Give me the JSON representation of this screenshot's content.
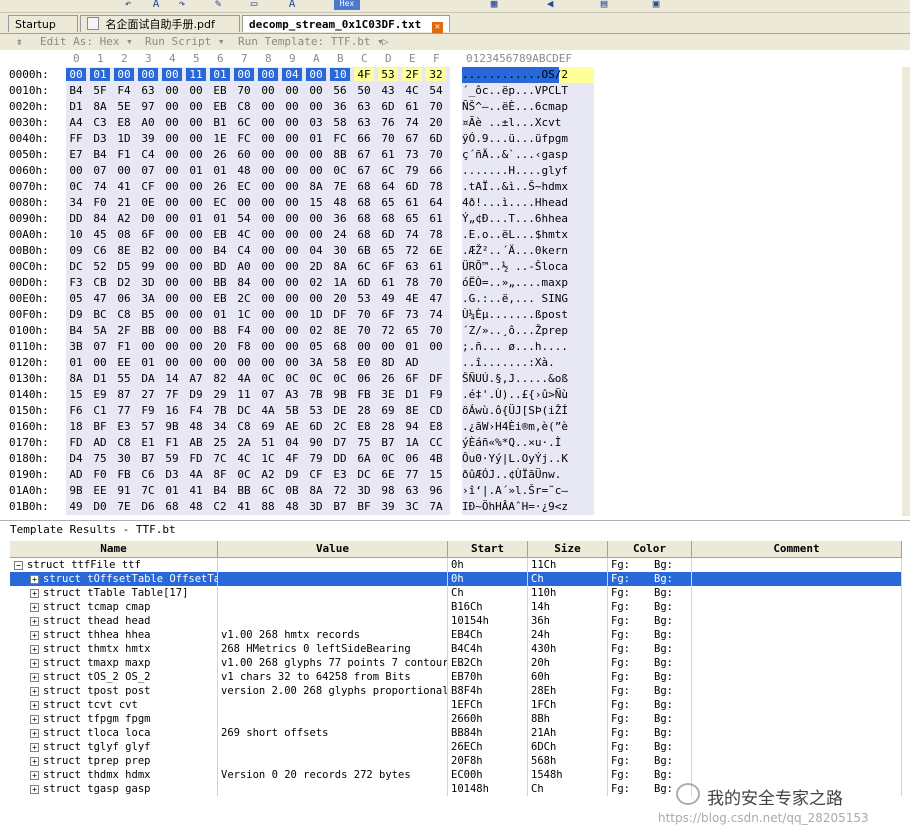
{
  "tabs": [
    {
      "label": "Startup",
      "active": false
    },
    {
      "label": "名企面试自助手册.pdf",
      "active": false
    },
    {
      "label": "decomp_stream_0x1C03DF.txt",
      "active": true
    }
  ],
  "editor_toolbar": {
    "edit_as": "Edit As: Hex",
    "run_script": "Run Script",
    "run_template": "Run Template: TTF.bt"
  },
  "hex_header": {
    "columns": [
      "0",
      "1",
      "2",
      "3",
      "4",
      "5",
      "6",
      "7",
      "8",
      "9",
      "A",
      "B",
      "C",
      "D",
      "E",
      "F"
    ],
    "ascii_header": "0123456789ABCDEF"
  },
  "hex_rows": [
    {
      "addr": "0000h:",
      "bytes": [
        "00",
        "01",
        "00",
        "00",
        "00",
        "11",
        "01",
        "00",
        "00",
        "04",
        "00",
        "10",
        "4F",
        "53",
        "2F",
        "32"
      ],
      "ascii": "............OS/2"
    },
    {
      "addr": "0010h:",
      "bytes": [
        "B4",
        "5F",
        "F4",
        "63",
        "00",
        "00",
        "EB",
        "70",
        "00",
        "00",
        "00",
        "56",
        "50",
        "43",
        "4C",
        "54"
      ],
      "ascii": "´_ôc..ëp...VPCLT"
    },
    {
      "addr": "0020h:",
      "bytes": [
        "D1",
        "8A",
        "5E",
        "97",
        "00",
        "00",
        "EB",
        "C8",
        "00",
        "00",
        "00",
        "36",
        "63",
        "6D",
        "61",
        "70"
      ],
      "ascii": "ÑŠ^—..ëÈ...6cmap"
    },
    {
      "addr": "0030h:",
      "bytes": [
        "A4",
        "C3",
        "E8",
        "A0",
        "00",
        "00",
        "B1",
        "6C",
        "00",
        "00",
        "03",
        "58",
        "63",
        "76",
        "74",
        "20"
      ],
      "ascii": "¤Ãè ..±l...Xcvt "
    },
    {
      "addr": "0040h:",
      "bytes": [
        "FF",
        "D3",
        "1D",
        "39",
        "00",
        "00",
        "1E",
        "FC",
        "00",
        "00",
        "01",
        "FC",
        "66",
        "70",
        "67",
        "6D"
      ],
      "ascii": "ÿÓ.9...ü...üfpgm"
    },
    {
      "addr": "0050h:",
      "bytes": [
        "E7",
        "B4",
        "F1",
        "C4",
        "00",
        "00",
        "26",
        "60",
        "00",
        "00",
        "00",
        "8B",
        "67",
        "61",
        "73",
        "70"
      ],
      "ascii": "ç´ñÄ..&`...‹gasp"
    },
    {
      "addr": "0060h:",
      "bytes": [
        "00",
        "07",
        "00",
        "07",
        "00",
        "01",
        "01",
        "48",
        "00",
        "00",
        "00",
        "0C",
        "67",
        "6C",
        "79",
        "66"
      ],
      "ascii": ".......H....glyf"
    },
    {
      "addr": "0070h:",
      "bytes": [
        "0C",
        "74",
        "41",
        "CF",
        "00",
        "00",
        "26",
        "EC",
        "00",
        "00",
        "8A",
        "7E",
        "68",
        "64",
        "6D",
        "78"
      ],
      "ascii": ".tAÏ..&ì..Š~hdmx"
    },
    {
      "addr": "0080h:",
      "bytes": [
        "34",
        "F0",
        "21",
        "0E",
        "00",
        "00",
        "EC",
        "00",
        "00",
        "00",
        "15",
        "48",
        "68",
        "65",
        "61",
        "64"
      ],
      "ascii": "4ð!...ì....Hhead"
    },
    {
      "addr": "0090h:",
      "bytes": [
        "DD",
        "84",
        "A2",
        "D0",
        "00",
        "01",
        "01",
        "54",
        "00",
        "00",
        "00",
        "36",
        "68",
        "68",
        "65",
        "61"
      ],
      "ascii": "Ý„¢Ð...T...6hhea"
    },
    {
      "addr": "00A0h:",
      "bytes": [
        "10",
        "45",
        "08",
        "6F",
        "00",
        "00",
        "EB",
        "4C",
        "00",
        "00",
        "00",
        "24",
        "68",
        "6D",
        "74",
        "78"
      ],
      "ascii": ".E.o..ëL...$hmtx"
    },
    {
      "addr": "00B0h:",
      "bytes": [
        "09",
        "C6",
        "8E",
        "B2",
        "00",
        "00",
        "B4",
        "C4",
        "00",
        "00",
        "04",
        "30",
        "6B",
        "65",
        "72",
        "6E"
      ],
      "ascii": ".ÆŽ²..´Ä...0kern"
    },
    {
      "addr": "00C0h:",
      "bytes": [
        "DC",
        "52",
        "D5",
        "99",
        "00",
        "00",
        "BD",
        "A0",
        "00",
        "00",
        "2D",
        "8A",
        "6C",
        "6F",
        "63",
        "61"
      ],
      "ascii": "ÜRÕ™..½ ..-Šloca"
    },
    {
      "addr": "00D0h:",
      "bytes": [
        "F3",
        "CB",
        "D2",
        "3D",
        "00",
        "00",
        "BB",
        "84",
        "00",
        "00",
        "02",
        "1A",
        "6D",
        "61",
        "78",
        "70"
      ],
      "ascii": "óËÒ=..»„....maxp"
    },
    {
      "addr": "00E0h:",
      "bytes": [
        "05",
        "47",
        "06",
        "3A",
        "00",
        "00",
        "EB",
        "2C",
        "00",
        "00",
        "00",
        "20",
        "53",
        "49",
        "4E",
        "47"
      ],
      "ascii": ".G.:..ë,... SING"
    },
    {
      "addr": "00F0h:",
      "bytes": [
        "D9",
        "BC",
        "C8",
        "B5",
        "00",
        "00",
        "01",
        "1C",
        "00",
        "00",
        "1D",
        "DF",
        "70",
        "6F",
        "73",
        "74"
      ],
      "ascii": "Ù¼Èµ.......ßpost"
    },
    {
      "addr": "0100h:",
      "bytes": [
        "B4",
        "5A",
        "2F",
        "BB",
        "00",
        "00",
        "B8",
        "F4",
        "00",
        "00",
        "02",
        "8E",
        "70",
        "72",
        "65",
        "70"
      ],
      "ascii": "´Z/»..¸ô...Žprep"
    },
    {
      "addr": "0110h:",
      "bytes": [
        "3B",
        "07",
        "F1",
        "00",
        "00",
        "00",
        "20",
        "F8",
        "00",
        "00",
        "05",
        "68",
        "00",
        "00",
        "01",
        "00"
      ],
      "ascii": ";.ñ... ø...h...."
    },
    {
      "addr": "0120h:",
      "bytes": [
        "01",
        "00",
        "EE",
        "01",
        "00",
        "00",
        "00",
        "00",
        "00",
        "00",
        "3A",
        "58",
        "E0",
        "8D",
        "AD"
      ],
      "ascii": "..î.......:Xà.­"
    },
    {
      "addr": "0130h:",
      "bytes": [
        "8A",
        "D1",
        "55",
        "DA",
        "14",
        "A7",
        "82",
        "4A",
        "0C",
        "0C",
        "0C",
        "0C",
        "06",
        "26",
        "6F",
        "DF"
      ],
      "ascii": "ŠÑUÚ.§‚J.....&oß"
    },
    {
      "addr": "0140h:",
      "bytes": [
        "15",
        "E9",
        "87",
        "27",
        "7F",
        "D9",
        "29",
        "11",
        "07",
        "A3",
        "7B",
        "9B",
        "FB",
        "3E",
        "D1",
        "F9"
      ],
      "ascii": ".é‡'.Ù)..£{›û>Ñù"
    },
    {
      "addr": "0150h:",
      "bytes": [
        "F6",
        "C1",
        "77",
        "F9",
        "16",
        "F4",
        "7B",
        "DC",
        "4A",
        "5B",
        "53",
        "DE",
        "28",
        "69",
        "8E",
        "CD"
      ],
      "ascii": "öÁwù.ô{ÜJ[SÞ(iŽÍ"
    },
    {
      "addr": "0160h:",
      "bytes": [
        "18",
        "BF",
        "E3",
        "57",
        "9B",
        "48",
        "34",
        "C8",
        "69",
        "AE",
        "6D",
        "2C",
        "E8",
        "28",
        "94",
        "E8"
      ],
      "ascii": ".¿ãW›H4Èi®m,è(”è"
    },
    {
      "addr": "0170h:",
      "bytes": [
        "FD",
        "AD",
        "C8",
        "E1",
        "F1",
        "AB",
        "25",
        "2A",
        "51",
        "04",
        "90",
        "D7",
        "75",
        "B7",
        "1A",
        "CC"
      ],
      "ascii": "ý­Èáñ«%*Q..×u·.Ì"
    },
    {
      "addr": "0180h:",
      "bytes": [
        "D4",
        "75",
        "30",
        "B7",
        "59",
        "FD",
        "7C",
        "4C",
        "1C",
        "4F",
        "79",
        "DD",
        "6A",
        "0C",
        "06",
        "4B"
      ],
      "ascii": "Ôu0·Yý|L.OyÝj..K"
    },
    {
      "addr": "0190h:",
      "bytes": [
        "AD",
        "F0",
        "FB",
        "C6",
        "D3",
        "4A",
        "8F",
        "0C",
        "A2",
        "D9",
        "CF",
        "E3",
        "DC",
        "6E",
        "77",
        "15"
      ],
      "ascii": "­ðûÆÓJ..¢ÙÏãÜnw."
    },
    {
      "addr": "01A0h:",
      "bytes": [
        "9B",
        "EE",
        "91",
        "7C",
        "01",
        "41",
        "B4",
        "BB",
        "6C",
        "0B",
        "8A",
        "72",
        "3D",
        "98",
        "63",
        "96"
      ],
      "ascii": "›î‘|.A´»l.Šr=˜c–"
    },
    {
      "addr": "01B0h:",
      "bytes": [
        "49",
        "D0",
        "7E",
        "D6",
        "68",
        "48",
        "C2",
        "41",
        "88",
        "48",
        "3D",
        "B7",
        "BF",
        "39",
        "3C",
        "7A"
      ],
      "ascii": "IÐ~ÖhHÂAˆH=·¿9<z"
    }
  ],
  "template_results": {
    "title": "Template Results - TTF.bt",
    "columns": [
      "Name",
      "Value",
      "Start",
      "Size",
      "Color",
      "Comment"
    ],
    "rows": [
      {
        "name": "struct ttfFile ttf",
        "value": "",
        "start": "0h",
        "size": "11Ch",
        "fg": "Fg:",
        "bg": "Bg:",
        "expander": "−",
        "indent": 0,
        "selected": false
      },
      {
        "name": "struct tOffsetTable OffsetTable",
        "value": "",
        "start": "0h",
        "size": "Ch",
        "fg": "Fg:",
        "bg": "Bg:",
        "expander": "+",
        "indent": 1,
        "selected": true
      },
      {
        "name": "struct tTable Table[17]",
        "value": "",
        "start": "Ch",
        "size": "110h",
        "fg": "Fg:",
        "bg": "Bg:",
        "expander": "+",
        "indent": 1,
        "selected": false
      },
      {
        "name": "struct tcmap cmap",
        "value": "",
        "start": "B16Ch",
        "size": "14h",
        "fg": "Fg:",
        "bg": "Bg:",
        "expander": "+",
        "indent": 1,
        "selected": false
      },
      {
        "name": "struct thead head",
        "value": "",
        "start": "10154h",
        "size": "36h",
        "fg": "Fg:",
        "bg": "Bg:",
        "expander": "+",
        "indent": 1,
        "selected": false
      },
      {
        "name": "struct thhea hhea",
        "value": "v1.00 268 hmtx records",
        "start": "EB4Ch",
        "size": "24h",
        "fg": "Fg:",
        "bg": "Bg:",
        "expander": "+",
        "indent": 1,
        "selected": false
      },
      {
        "name": "struct thmtx hmtx",
        "value": "268 HMetrics 0 leftSideBearing",
        "start": "B4C4h",
        "size": "430h",
        "fg": "Fg:",
        "bg": "Bg:",
        "expander": "+",
        "indent": 1,
        "selected": false
      },
      {
        "name": "struct tmaxp maxp",
        "value": "v1.00 268 glyphs 77 points 7 contours",
        "start": "EB2Ch",
        "size": "20h",
        "fg": "Fg:",
        "bg": "Bg:",
        "expander": "+",
        "indent": 1,
        "selected": false
      },
      {
        "name": "struct tOS_2 OS_2",
        "value": "v1 chars 32 to 64258 from Bits",
        "start": "EB70h",
        "size": "60h",
        "fg": "Fg:",
        "bg": "Bg:",
        "expander": "+",
        "indent": 1,
        "selected": false
      },
      {
        "name": "struct tpost post",
        "value": "version 2.00 268 glyphs proportional",
        "start": "B8F4h",
        "size": "28Eh",
        "fg": "Fg:",
        "bg": "Bg:",
        "expander": "+",
        "indent": 1,
        "selected": false
      },
      {
        "name": "struct tcvt cvt",
        "value": "",
        "start": "1EFCh",
        "size": "1FCh",
        "fg": "Fg:",
        "bg": "Bg:",
        "expander": "+",
        "indent": 1,
        "selected": false
      },
      {
        "name": "struct tfpgm fpgm",
        "value": "",
        "start": "2660h",
        "size": "8Bh",
        "fg": "Fg:",
        "bg": "Bg:",
        "expander": "+",
        "indent": 1,
        "selected": false
      },
      {
        "name": "struct tloca loca",
        "value": "269 short offsets",
        "start": "BB84h",
        "size": "21Ah",
        "fg": "Fg:",
        "bg": "Bg:",
        "expander": "+",
        "indent": 1,
        "selected": false
      },
      {
        "name": "struct tglyf glyf",
        "value": "",
        "start": "26ECh",
        "size": "6DCh",
        "fg": "Fg:",
        "bg": "Bg:",
        "expander": "+",
        "indent": 1,
        "selected": false
      },
      {
        "name": "struct tprep prep",
        "value": "",
        "start": "20F8h",
        "size": "568h",
        "fg": "Fg:",
        "bg": "Bg:",
        "expander": "+",
        "indent": 1,
        "selected": false
      },
      {
        "name": "struct thdmx hdmx",
        "value": "Version 0 20 records 272 bytes",
        "start": "EC00h",
        "size": "1548h",
        "fg": "Fg:",
        "bg": "Bg:",
        "expander": "+",
        "indent": 1,
        "selected": false
      },
      {
        "name": "struct tgasp gasp",
        "value": "",
        "start": "10148h",
        "size": "Ch",
        "fg": "Fg:",
        "bg": "Bg:",
        "expander": "+",
        "indent": 1,
        "selected": false
      }
    ]
  },
  "watermark": {
    "name": "我的安全专家之路",
    "url": "https://blog.csdn.net/qq_28205153"
  },
  "colors": {
    "selection": "#2868d8",
    "highlight": "#ffff99",
    "hex_bg": "#e8e8f4",
    "chrome": "#ece9d8"
  }
}
